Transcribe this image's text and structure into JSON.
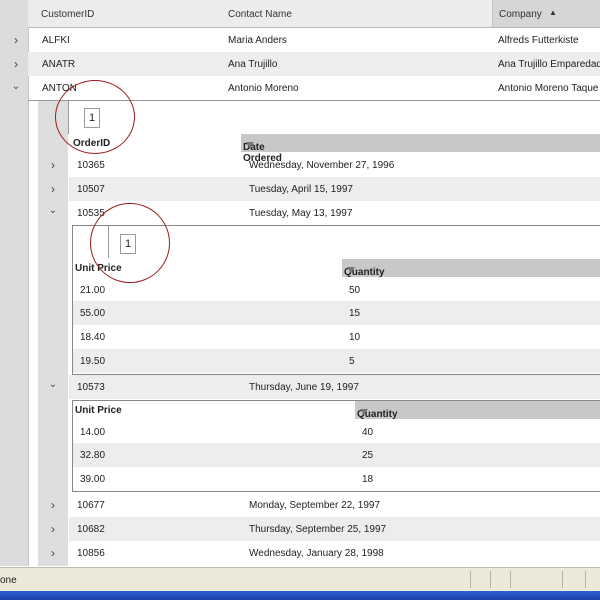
{
  "header": {
    "col1": "CustomerID",
    "col2": "Contact Name",
    "col3": "Company",
    "sort_indicator": "▲"
  },
  "customers": [
    {
      "id": "ALFKI",
      "contact": "Maria Anders",
      "company": "Alfreds Futterkiste"
    },
    {
      "id": "ANATR",
      "contact": "Ana Trujillo",
      "company": "Ana Trujillo Emparedad"
    },
    {
      "id": "ANTON",
      "contact": "Antonio Moreno",
      "company": "Antonio Moreno Taque"
    }
  ],
  "orders_panel": {
    "page_number": "1",
    "col_order": "OrderID",
    "col_date": "Date Ordered",
    "rows": [
      {
        "id": "10365",
        "date": "Wednesday, November 27, 1996"
      },
      {
        "id": "10507",
        "date": "Tuesday, April 15, 1997"
      },
      {
        "id": "10535",
        "date": "Tuesday, May 13, 1997"
      },
      {
        "id": "10573",
        "date": "Thursday, June 19, 1997"
      },
      {
        "id": "10677",
        "date": "Monday, September 22, 1997"
      },
      {
        "id": "10682",
        "date": "Thursday, September 25, 1997"
      },
      {
        "id": "10856",
        "date": "Wednesday, January 28, 1998"
      }
    ]
  },
  "detail_10535": {
    "page_number": "1",
    "col_price": "Unit Price",
    "col_qty": "Quantity",
    "rows": [
      {
        "price": "21.00",
        "qty": "50"
      },
      {
        "price": "55.00",
        "qty": "15"
      },
      {
        "price": "18.40",
        "qty": "10"
      },
      {
        "price": "19.50",
        "qty": "5"
      }
    ]
  },
  "detail_10573": {
    "col_price": "Unit Price",
    "col_qty": "Quantity",
    "rows": [
      {
        "price": "14.00",
        "qty": "40"
      },
      {
        "price": "32.80",
        "qty": "25"
      },
      {
        "price": "39.00",
        "qty": "18"
      }
    ]
  },
  "status": {
    "text": "one"
  },
  "colors": {
    "annotation_circle": "#9b1d1d",
    "header_bg": "#ececec",
    "taskbar": "#2e5fd0"
  }
}
